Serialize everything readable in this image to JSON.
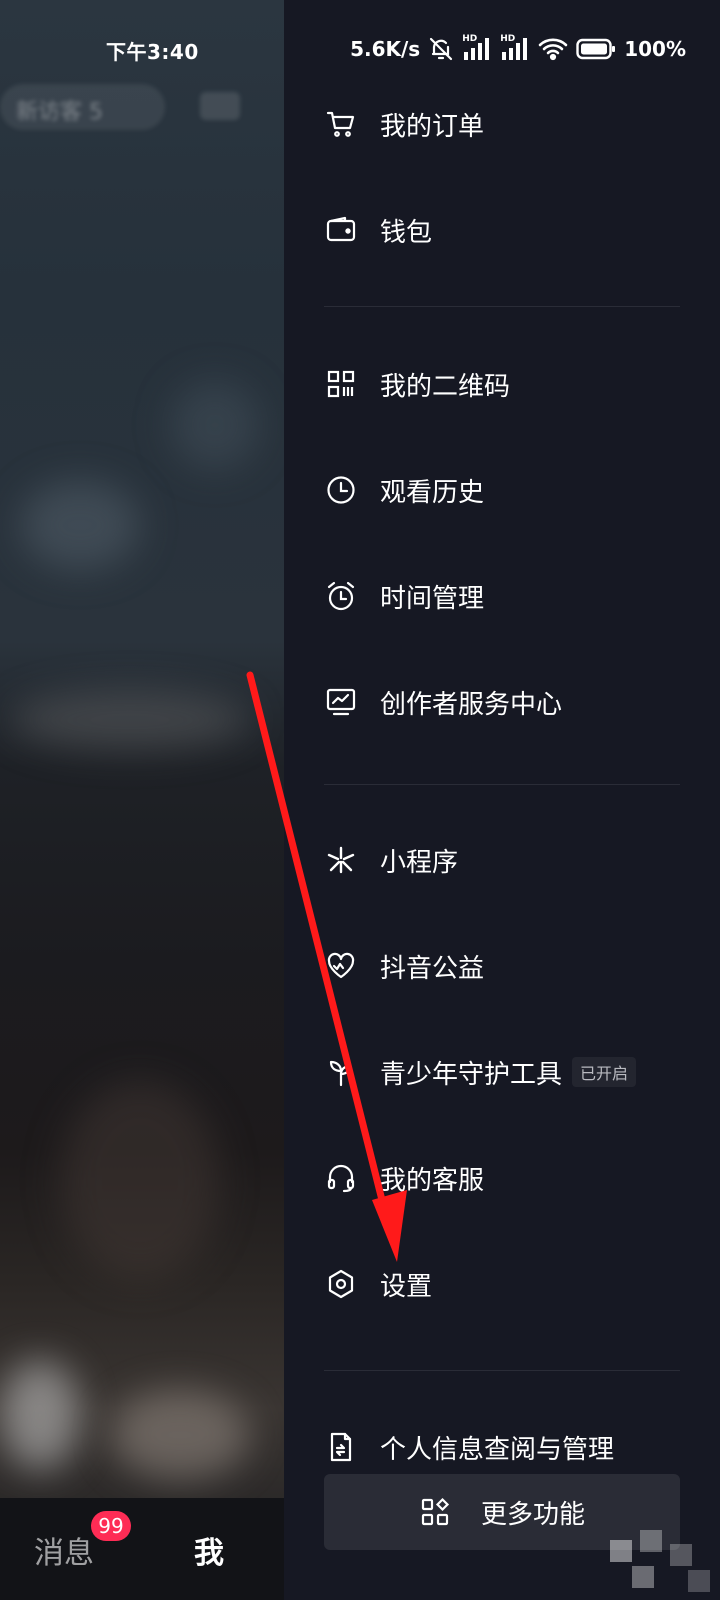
{
  "status_bar": {
    "time": "下午3:40",
    "net_speed": "5.6K/s",
    "signal_label": "HD",
    "battery": "100%"
  },
  "background": {
    "pill_text": "新访客 5"
  },
  "drawer": {
    "items": [
      {
        "label": "我的订单",
        "icon": "cart-icon"
      },
      {
        "label": "钱包",
        "icon": "wallet-icon"
      },
      {
        "label": "我的二维码",
        "icon": "qr-code-icon"
      },
      {
        "label": "观看历史",
        "icon": "clock-icon"
      },
      {
        "label": "时间管理",
        "icon": "alarm-icon"
      },
      {
        "label": "创作者服务中心",
        "icon": "chart-icon"
      },
      {
        "label": "小程序",
        "icon": "mini-program-icon"
      },
      {
        "label": "抖音公益",
        "icon": "heart-icon"
      },
      {
        "label": "青少年守护工具",
        "icon": "sprout-icon",
        "badge": "已开启"
      },
      {
        "label": "我的客服",
        "icon": "headset-icon"
      },
      {
        "label": "设置",
        "icon": "settings-icon"
      },
      {
        "label": "个人信息查阅与管理",
        "icon": "document-icon"
      }
    ],
    "more_button": "更多功能"
  },
  "tabbar": {
    "messages_label": "消息",
    "messages_badge": "99",
    "me_label": "我"
  },
  "colors": {
    "drawer_bg": "#161823",
    "badge_red": "#fe2c55",
    "arrow_red": "#ff1a1a"
  }
}
